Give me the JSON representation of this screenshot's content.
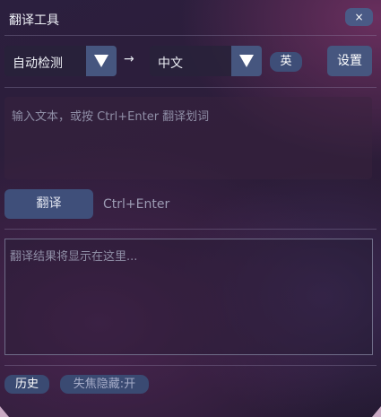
{
  "window": {
    "title": "翻译工具",
    "close_label": "×"
  },
  "lang": {
    "source": "自动检测",
    "arrow": "→",
    "target": "中文",
    "quick_toggle": "英",
    "settings_label": "设置"
  },
  "input": {
    "placeholder": "输入文本，或按 Ctrl+Enter 翻译划词"
  },
  "actions": {
    "translate_label": "翻译",
    "shortcut_hint": "Ctrl+Enter"
  },
  "result": {
    "placeholder": "翻译结果将显示在这里..."
  },
  "footer": {
    "history_label": "历史",
    "blur_hide_label": "失焦隐藏:开"
  },
  "colors": {
    "accent": "#46567f",
    "chip": "#3a4a72",
    "border": "#6f6c88"
  }
}
